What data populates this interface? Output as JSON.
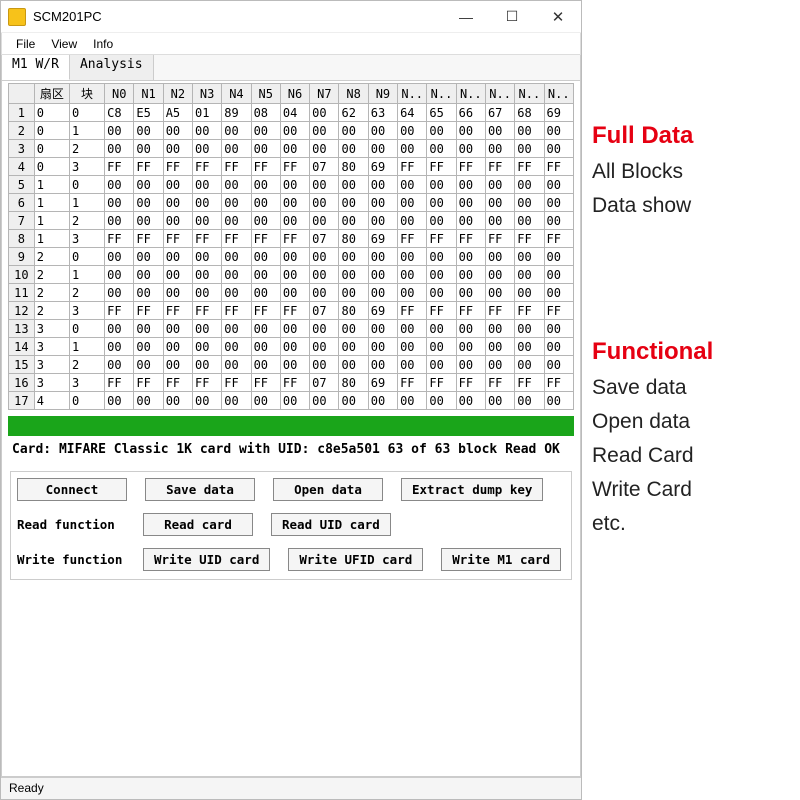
{
  "window": {
    "title": "SCM201PC",
    "minimize": "—",
    "maximize": "☐",
    "close": "✕"
  },
  "menu": {
    "file": "File",
    "view": "View",
    "info": "Info"
  },
  "tabs": {
    "t0": "M1 W/R",
    "t1": "Analysis"
  },
  "grid": {
    "headers": [
      "扇区",
      "块",
      "N0",
      "N1",
      "N2",
      "N3",
      "N4",
      "N5",
      "N6",
      "N7",
      "N8",
      "N9",
      "N..",
      "N..",
      "N..",
      "N..",
      "N..",
      "N.."
    ],
    "rows": [
      {
        "n": "1",
        "sector": "0",
        "block": "0",
        "b": [
          "C8",
          "E5",
          "A5",
          "01",
          "89",
          "08",
          "04",
          "00",
          "62",
          "63",
          "64",
          "65",
          "66",
          "67",
          "68",
          "69"
        ]
      },
      {
        "n": "2",
        "sector": "0",
        "block": "1",
        "b": [
          "00",
          "00",
          "00",
          "00",
          "00",
          "00",
          "00",
          "00",
          "00",
          "00",
          "00",
          "00",
          "00",
          "00",
          "00",
          "00"
        ]
      },
      {
        "n": "3",
        "sector": "0",
        "block": "2",
        "b": [
          "00",
          "00",
          "00",
          "00",
          "00",
          "00",
          "00",
          "00",
          "00",
          "00",
          "00",
          "00",
          "00",
          "00",
          "00",
          "00"
        ]
      },
      {
        "n": "4",
        "sector": "0",
        "block": "3",
        "b": [
          "FF",
          "FF",
          "FF",
          "FF",
          "FF",
          "FF",
          "FF",
          "07",
          "80",
          "69",
          "FF",
          "FF",
          "FF",
          "FF",
          "FF",
          "FF"
        ]
      },
      {
        "n": "5",
        "sector": "1",
        "block": "0",
        "b": [
          "00",
          "00",
          "00",
          "00",
          "00",
          "00",
          "00",
          "00",
          "00",
          "00",
          "00",
          "00",
          "00",
          "00",
          "00",
          "00"
        ]
      },
      {
        "n": "6",
        "sector": "1",
        "block": "1",
        "b": [
          "00",
          "00",
          "00",
          "00",
          "00",
          "00",
          "00",
          "00",
          "00",
          "00",
          "00",
          "00",
          "00",
          "00",
          "00",
          "00"
        ]
      },
      {
        "n": "7",
        "sector": "1",
        "block": "2",
        "b": [
          "00",
          "00",
          "00",
          "00",
          "00",
          "00",
          "00",
          "00",
          "00",
          "00",
          "00",
          "00",
          "00",
          "00",
          "00",
          "00"
        ]
      },
      {
        "n": "8",
        "sector": "1",
        "block": "3",
        "b": [
          "FF",
          "FF",
          "FF",
          "FF",
          "FF",
          "FF",
          "FF",
          "07",
          "80",
          "69",
          "FF",
          "FF",
          "FF",
          "FF",
          "FF",
          "FF"
        ]
      },
      {
        "n": "9",
        "sector": "2",
        "block": "0",
        "b": [
          "00",
          "00",
          "00",
          "00",
          "00",
          "00",
          "00",
          "00",
          "00",
          "00",
          "00",
          "00",
          "00",
          "00",
          "00",
          "00"
        ]
      },
      {
        "n": "10",
        "sector": "2",
        "block": "1",
        "b": [
          "00",
          "00",
          "00",
          "00",
          "00",
          "00",
          "00",
          "00",
          "00",
          "00",
          "00",
          "00",
          "00",
          "00",
          "00",
          "00"
        ]
      },
      {
        "n": "11",
        "sector": "2",
        "block": "2",
        "b": [
          "00",
          "00",
          "00",
          "00",
          "00",
          "00",
          "00",
          "00",
          "00",
          "00",
          "00",
          "00",
          "00",
          "00",
          "00",
          "00"
        ]
      },
      {
        "n": "12",
        "sector": "2",
        "block": "3",
        "b": [
          "FF",
          "FF",
          "FF",
          "FF",
          "FF",
          "FF",
          "FF",
          "07",
          "80",
          "69",
          "FF",
          "FF",
          "FF",
          "FF",
          "FF",
          "FF"
        ]
      },
      {
        "n": "13",
        "sector": "3",
        "block": "0",
        "b": [
          "00",
          "00",
          "00",
          "00",
          "00",
          "00",
          "00",
          "00",
          "00",
          "00",
          "00",
          "00",
          "00",
          "00",
          "00",
          "00"
        ]
      },
      {
        "n": "14",
        "sector": "3",
        "block": "1",
        "b": [
          "00",
          "00",
          "00",
          "00",
          "00",
          "00",
          "00",
          "00",
          "00",
          "00",
          "00",
          "00",
          "00",
          "00",
          "00",
          "00"
        ]
      },
      {
        "n": "15",
        "sector": "3",
        "block": "2",
        "b": [
          "00",
          "00",
          "00",
          "00",
          "00",
          "00",
          "00",
          "00",
          "00",
          "00",
          "00",
          "00",
          "00",
          "00",
          "00",
          "00"
        ]
      },
      {
        "n": "16",
        "sector": "3",
        "block": "3",
        "b": [
          "FF",
          "FF",
          "FF",
          "FF",
          "FF",
          "FF",
          "FF",
          "07",
          "80",
          "69",
          "FF",
          "FF",
          "FF",
          "FF",
          "FF",
          "FF"
        ]
      },
      {
        "n": "17",
        "sector": "4",
        "block": "0",
        "b": [
          "00",
          "00",
          "00",
          "00",
          "00",
          "00",
          "00",
          "00",
          "00",
          "00",
          "00",
          "00",
          "00",
          "00",
          "00",
          "00"
        ]
      }
    ]
  },
  "status_msg": "Card: MIFARE Classic 1K card with UID: c8e5a501 63 of 63 block Read OK",
  "buttons": {
    "row1_label": "",
    "connect": "Connect",
    "save_data": "Save data",
    "open_data": "Open data",
    "extract_dump": "Extract dump key",
    "read_label": "Read function",
    "read_card": "Read card",
    "read_uid": "Read UID card",
    "write_label": "Write function",
    "write_uid": "Write UID card",
    "write_ufid": "Write UFID card",
    "write_m1": "Write M1 card"
  },
  "statusbar": "Ready",
  "annot": {
    "h1": "Full Data",
    "p1": "All Blocks",
    "p2": "Data show",
    "h2": "Functional",
    "q1": "Save data",
    "q2": "Open data",
    "q3": "Read Card",
    "q4": "Write Card",
    "q5": "etc."
  }
}
